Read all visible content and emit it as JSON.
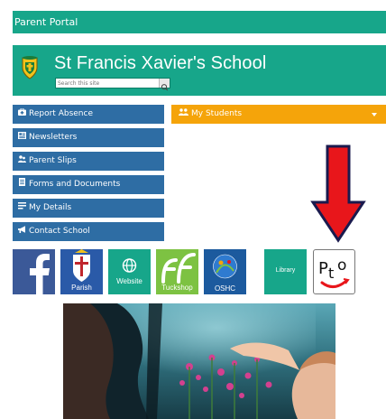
{
  "portal_title": "Parent Portal",
  "school": {
    "name": "St Francis Xavier's School",
    "search_placeholder": "Search this site"
  },
  "nav": [
    {
      "label": "Report Absence",
      "icon": "first-aid-icon"
    },
    {
      "label": "Newsletters",
      "icon": "newspaper-icon"
    },
    {
      "label": "Parent Slips",
      "icon": "users-icon"
    },
    {
      "label": "Forms and Documents",
      "icon": "document-icon"
    },
    {
      "label": "My Details",
      "icon": "list-icon"
    },
    {
      "label": "Contact School",
      "icon": "megaphone-icon"
    }
  ],
  "students": {
    "label": "My Students",
    "icon": "group-icon"
  },
  "tiles": [
    {
      "label": "",
      "icon": "facebook-icon",
      "color": "#3b5998"
    },
    {
      "label": "Parish",
      "icon": "parish-crest-icon",
      "color": "#2a5aa8"
    },
    {
      "label": "Website",
      "icon": "globe-icon",
      "color": "#17a68a"
    },
    {
      "label": "Tuckshop",
      "icon": "tuckshop-icon",
      "color": "#6ab04c"
    },
    {
      "label": "OSHC",
      "icon": "oshc-icon",
      "color": "#1c5a9e"
    },
    {
      "label": "Library",
      "icon": "library-icon",
      "color": "#17a68a"
    },
    {
      "label": "",
      "icon": "pto-icon",
      "color": "#ffffff"
    }
  ],
  "pto_logo_text": "PtO",
  "accent_colors": {
    "teal": "#17a68a",
    "nav_blue": "#2e6da4",
    "orange": "#f5a40a",
    "arrow_red": "#e8161b"
  }
}
